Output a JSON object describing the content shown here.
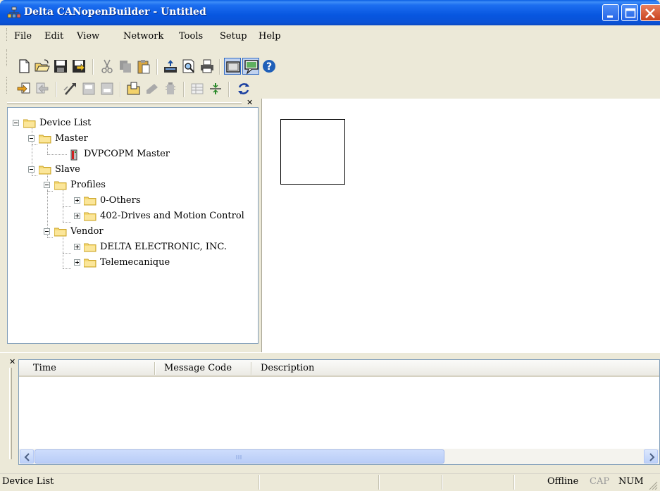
{
  "window": {
    "title": "Delta CANopenBuilder - Untitled",
    "titlebar_color": "#0a56de"
  },
  "menu": {
    "file": "File",
    "edit": "Edit",
    "view": "View",
    "network": "Network",
    "tools": "Tools",
    "setup": "Setup",
    "help": "Help"
  },
  "toolbar1": [
    {
      "icon": "new-icon"
    },
    {
      "icon": "open-icon"
    },
    {
      "icon": "save-icon"
    },
    {
      "icon": "save-as-icon"
    },
    {
      "icon": "cut-icon"
    },
    {
      "icon": "copy-icon"
    },
    {
      "icon": "paste-icon"
    },
    {
      "icon": "upload-icon"
    },
    {
      "icon": "print-preview-icon"
    },
    {
      "icon": "print-icon"
    },
    {
      "icon": "device-list-view-icon"
    },
    {
      "icon": "message-view-icon"
    },
    {
      "icon": "help-icon"
    }
  ],
  "toolbar2": [
    {
      "icon": "online-icon"
    },
    {
      "icon": "offline-icon"
    },
    {
      "icon": "scan-network-icon"
    },
    {
      "icon": "download-icon"
    },
    {
      "icon": "upload-device-icon"
    },
    {
      "icon": "open-profile-icon"
    },
    {
      "icon": "edit-profile-icon"
    },
    {
      "icon": "delete-device-icon"
    },
    {
      "icon": "table-icon"
    },
    {
      "icon": "connect-icon"
    },
    {
      "icon": "refresh-icon"
    }
  ],
  "tree": {
    "root": "Device List",
    "master": "Master",
    "master_device": "DVPCOPM Master",
    "slave": "Slave",
    "profiles": "Profiles",
    "profile_0": "0-Others",
    "profile_402": "402-Drives and Motion Control",
    "vendor": "Vendor",
    "vendor_delta": "DELTA ELECTRONIC, INC.",
    "vendor_tele": "Telemecanique"
  },
  "messages": {
    "columns": [
      "Time",
      "Message Code",
      "Description"
    ],
    "rows": []
  },
  "status": {
    "left": "Device List",
    "mode": "Offline",
    "cap": "CAP",
    "num": "NUM"
  }
}
